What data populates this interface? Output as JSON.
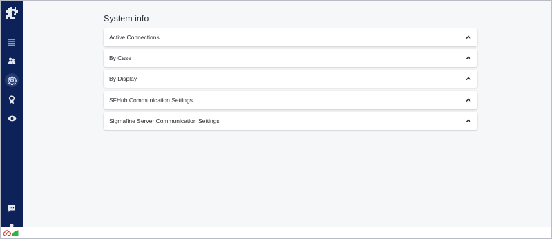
{
  "sidebar": {
    "items": [
      {
        "name": "logo",
        "icon": "puzzle-gear-logo"
      },
      {
        "name": "dashboard",
        "icon": "list-icon"
      },
      {
        "name": "users",
        "icon": "users-icon"
      },
      {
        "name": "settings",
        "icon": "gear-icon",
        "active": true
      },
      {
        "name": "awards",
        "icon": "award-icon"
      },
      {
        "name": "view",
        "icon": "eye-icon"
      },
      {
        "name": "messages",
        "icon": "chat-icon"
      },
      {
        "name": "profile",
        "icon": "user-icon"
      }
    ]
  },
  "main": {
    "title": "System info",
    "sections": [
      {
        "label": "Active Connections",
        "expanded": false
      },
      {
        "label": "By Case",
        "expanded": false
      },
      {
        "label": "By Display",
        "expanded": false
      },
      {
        "label": "SFHub Communication Settings",
        "expanded": false
      },
      {
        "label": "Sigmafine Server Communication Settings",
        "expanded": false
      }
    ]
  },
  "status": {
    "icons": [
      "cloud-disconnected-icon",
      "signal-icon"
    ],
    "colors": {
      "disconnected": "#d9342b",
      "signal": "#2fb344"
    }
  },
  "colors": {
    "sidebar": "#0c2258",
    "background": "#f6f7f9",
    "card": "#ffffff"
  }
}
